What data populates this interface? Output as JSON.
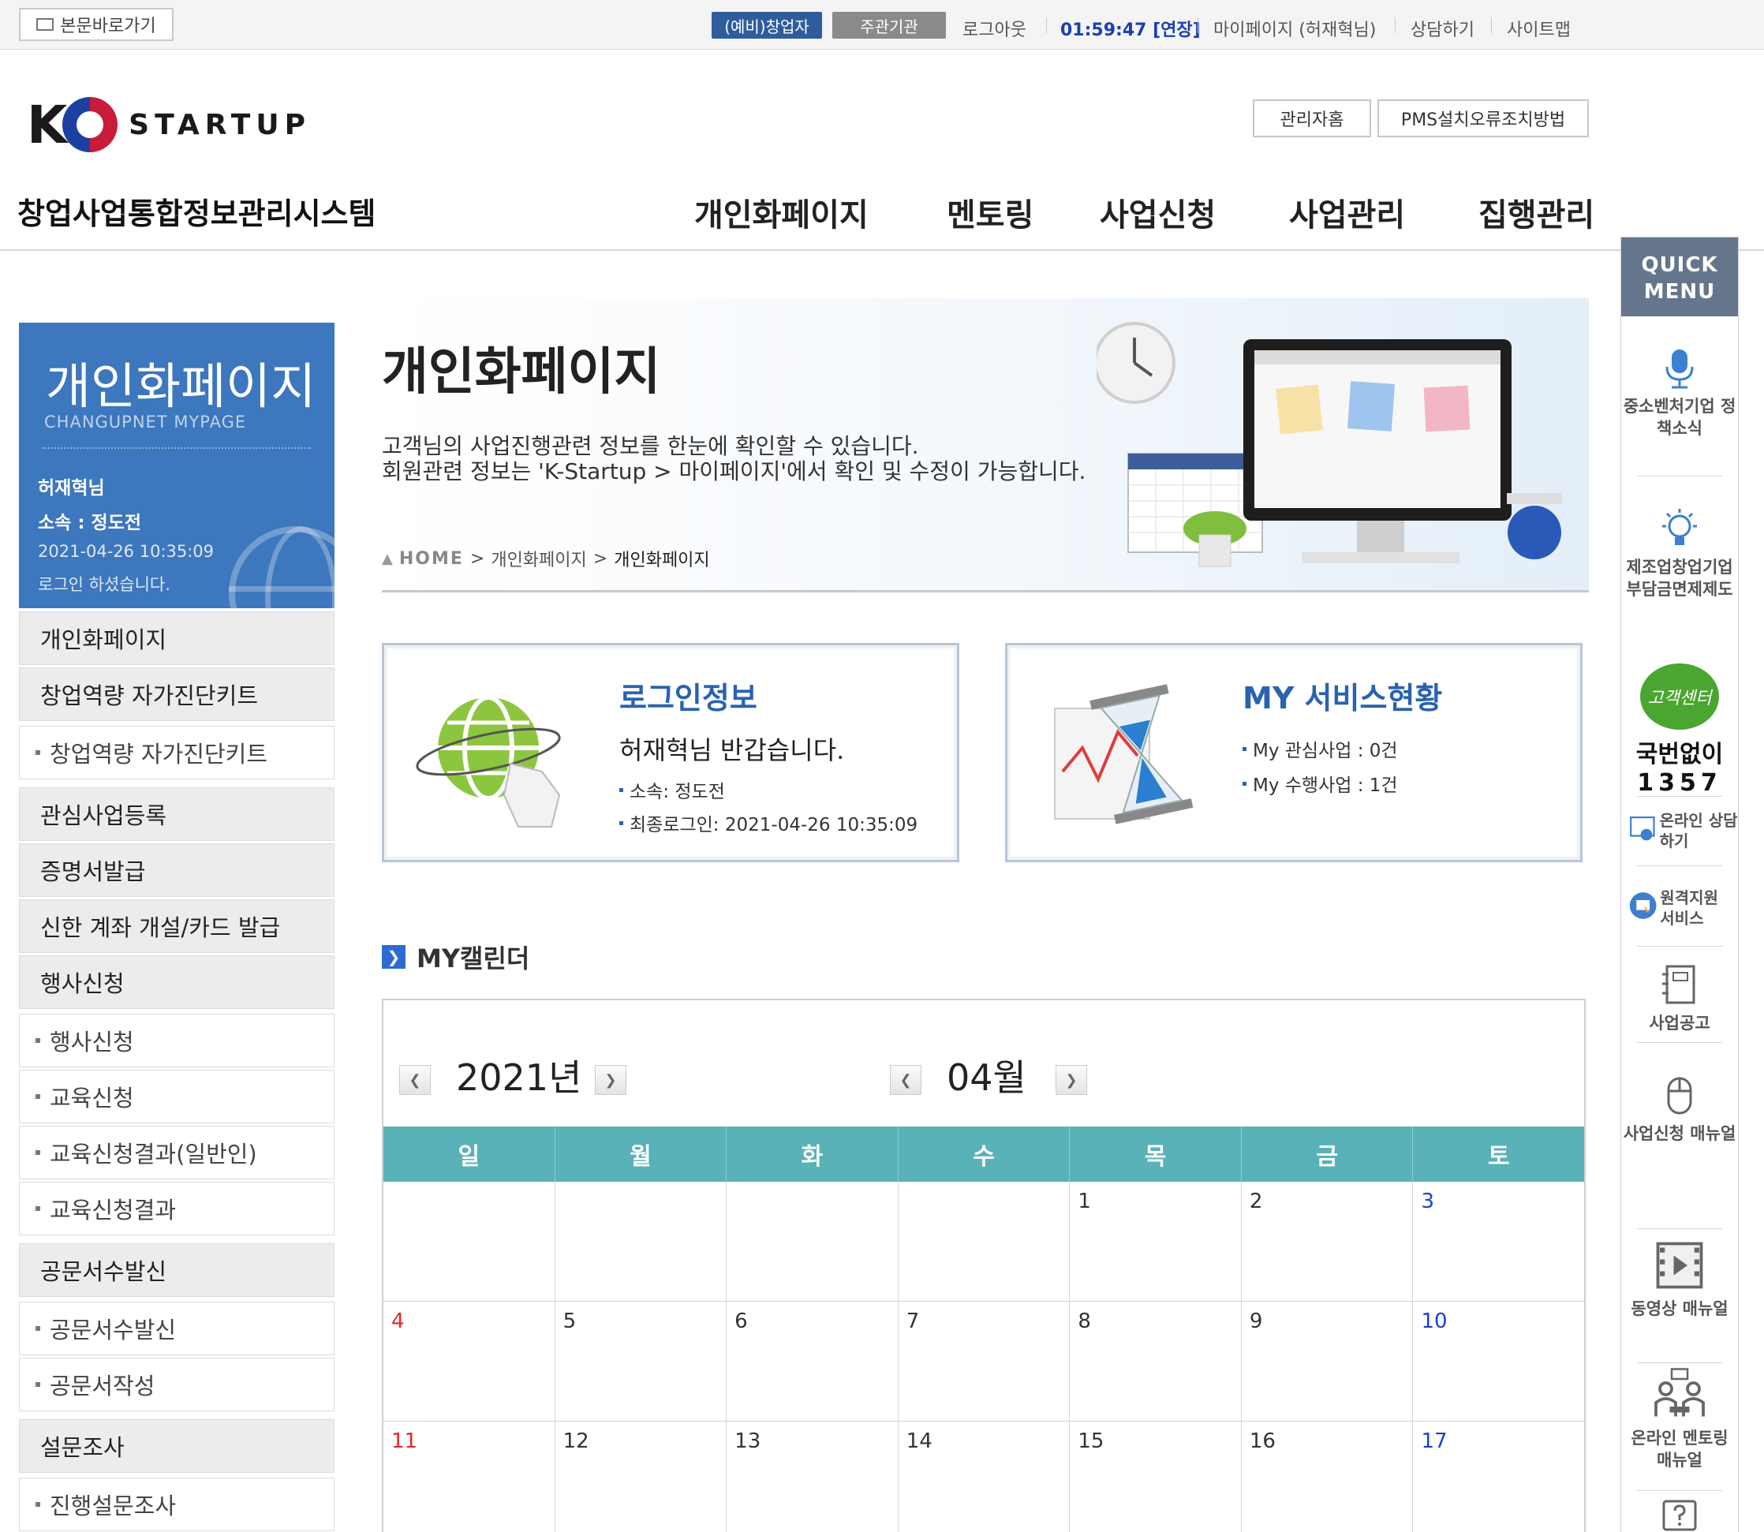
{
  "topbar": {
    "skip_label": "본문바로가기",
    "role_btn_1": "(예비)창업자",
    "role_btn_2": "주관기관",
    "logout": "로그아웃",
    "timer": "01:59:47 [연장]",
    "mypage": "마이페이지 (허재혁님)",
    "consult": "상담하기",
    "sitemap": "사이트맵"
  },
  "header": {
    "logo_letter": "K",
    "logo_text": "STARTUP",
    "system_title": "창업사업통합정보관리시스템",
    "admin_home": "관리자홈",
    "pms_fix": "PMS설치오류조치방법",
    "gnb": [
      "개인화페이지",
      "멘토링",
      "사업신청",
      "사업관리",
      "집행관리"
    ]
  },
  "sidebar": {
    "banner_title": "개인화페이지",
    "banner_sub": "CHANGUPNET MYPAGE",
    "user_name": "허재혁님",
    "user_dept": "소속 : 정도전",
    "login_datetime": "2021-04-26 10:35:09",
    "login_msg": "로그인 하셨습니다.",
    "items": [
      {
        "label": "개인화페이지",
        "type": "main"
      },
      {
        "label": "창업역량 자가진단키트",
        "type": "main"
      },
      {
        "label": "창업역량 자가진단키트",
        "type": "sub"
      },
      {
        "label": "관심사업등록",
        "type": "main"
      },
      {
        "label": "증명서발급",
        "type": "main"
      },
      {
        "label": "신한 계좌 개설/카드 발급",
        "type": "main"
      },
      {
        "label": "행사신청",
        "type": "main"
      },
      {
        "label": "행사신청",
        "type": "sub"
      },
      {
        "label": "교육신청",
        "type": "sub"
      },
      {
        "label": "교육신청결과(일반인)",
        "type": "sub"
      },
      {
        "label": "교육신청결과",
        "type": "sub"
      },
      {
        "label": "공문서수발신",
        "type": "main"
      },
      {
        "label": "공문서수발신",
        "type": "sub"
      },
      {
        "label": "공문서작성",
        "type": "sub"
      },
      {
        "label": "설문조사",
        "type": "main"
      },
      {
        "label": "진행설문조사",
        "type": "sub"
      }
    ]
  },
  "visual": {
    "title": "개인화페이지",
    "desc1": "고객님의 사업진행관련 정보를 한눈에 확인할 수 있습니다.",
    "desc2": "회원관련 정보는 'K-Startup > 마이페이지'에서 확인 및 수정이 가능합니다.",
    "breadcrumb_home": "HOME",
    "breadcrumb_sep1": ">",
    "breadcrumb_mid": "개인화페이지",
    "breadcrumb_sep2": ">",
    "breadcrumb_current": "개인화페이지"
  },
  "login_card": {
    "title": "로그인정보",
    "greeting": "허재혁님 반갑습니다.",
    "dept": "소속: 정도전",
    "last_login": "최종로그인: 2021-04-26 10:35:09"
  },
  "service_card": {
    "title": "MY 서비스현황",
    "interest": "My 관심사업 : 0건",
    "running": "My 수행사업 : 1건"
  },
  "calendar": {
    "section_title": "MY캘린더",
    "year_label": "2021년",
    "month_label": "04월",
    "weekdays": [
      "일",
      "월",
      "화",
      "수",
      "목",
      "금",
      "토"
    ],
    "weeks": [
      [
        "",
        "",
        "",
        "",
        "1",
        "2",
        "3"
      ],
      [
        "4",
        "5",
        "6",
        "7",
        "8",
        "9",
        "10"
      ],
      [
        "11",
        "12",
        "13",
        "14",
        "15",
        "16",
        "17"
      ]
    ]
  },
  "quick_menu": {
    "title_line1": "QUICK",
    "title_line2": "MENU",
    "item1": "중소벤처기업 정책소식",
    "item2": "제조업창업기업 부담금면제제도",
    "call_bubble": "고객센터",
    "call_line1": "국번없이",
    "call_line2": "1357",
    "item3": "온라인 상담하기",
    "item4": "원격지원 서비스",
    "item5": "사업공고",
    "item6": "사업신청 매뉴얼",
    "item7": "동영상 매뉴얼",
    "item8": "온라인 멘토링 매뉴얼"
  },
  "colors": {
    "brand_blue": "#3d77bd",
    "card_title": "#2a62b0",
    "calendar_header": "#58b2b7",
    "sunday": "#e02a2a",
    "saturday": "#1f3fcf",
    "quick_header": "#65768c"
  }
}
